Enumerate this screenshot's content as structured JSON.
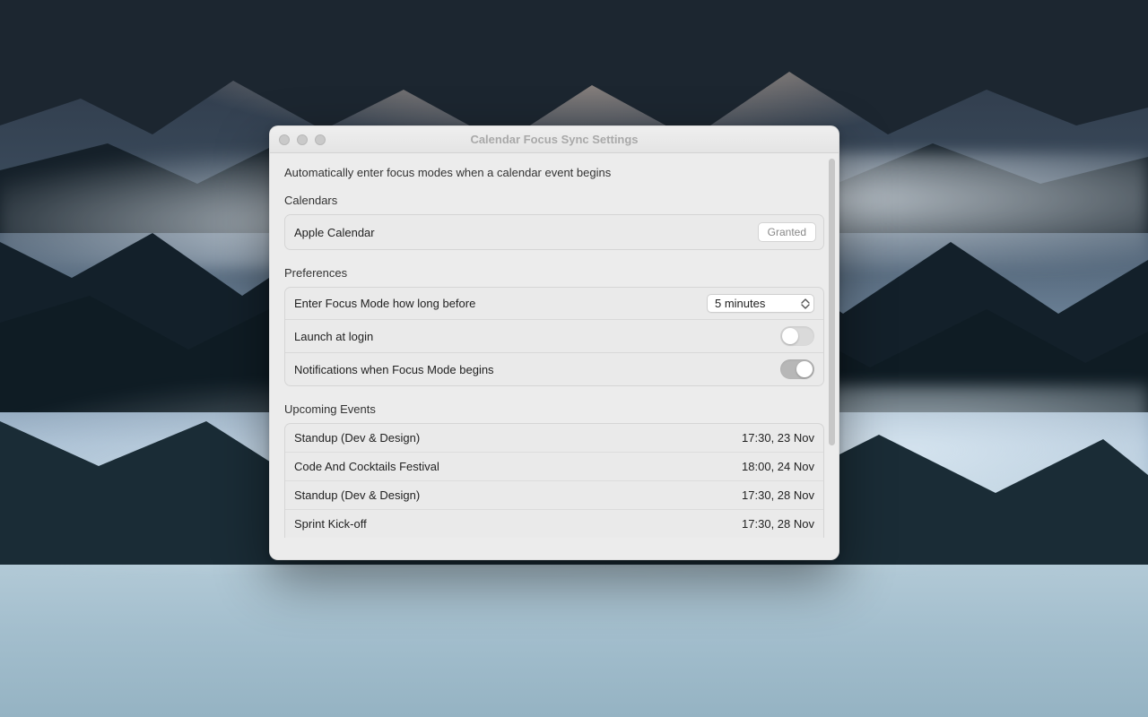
{
  "window": {
    "title": "Calendar Focus Sync Settings",
    "subtitle": "Automatically enter focus modes when a calendar event begins"
  },
  "calendars": {
    "section_label": "Calendars",
    "items": [
      {
        "name": "Apple Calendar",
        "status": "Granted"
      }
    ]
  },
  "preferences": {
    "section_label": "Preferences",
    "lead_time": {
      "label": "Enter Focus Mode how long before",
      "value": "5 minutes"
    },
    "launch_at_login": {
      "label": "Launch at login",
      "enabled": false
    },
    "notifications": {
      "label": "Notifications when Focus Mode begins",
      "enabled": true
    }
  },
  "upcoming": {
    "section_label": "Upcoming Events",
    "events": [
      {
        "title": "Standup (Dev & Design)",
        "time": "17:30, 23 Nov"
      },
      {
        "title": "Code And Cocktails Festival",
        "time": "18:00, 24 Nov"
      },
      {
        "title": "Standup (Dev & Design)",
        "time": "17:30, 28 Nov"
      },
      {
        "title": "Sprint Kick-off",
        "time": "17:30, 28 Nov"
      }
    ]
  }
}
